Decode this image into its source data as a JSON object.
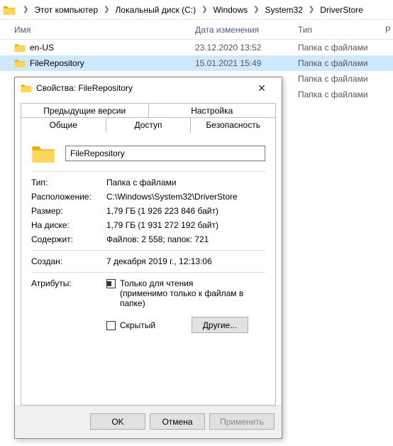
{
  "breadcrumb": {
    "items": [
      "Этот компьютер",
      "Локальный диск (C:)",
      "Windows",
      "System32",
      "DriverStore"
    ]
  },
  "columns": {
    "name": "Имя",
    "date": "Дата изменения",
    "type": "Тип",
    "extra": "Р"
  },
  "rows": [
    {
      "name": "en-US",
      "date": "23.12.2020 13:52",
      "type": "Папка с файлами",
      "selected": false
    },
    {
      "name": "FileRepository",
      "date": "15.01.2021 15:49",
      "type": "Папка с файлами",
      "selected": true
    },
    {
      "name": "",
      "date": "",
      "type": "Папка с файлами",
      "selected": false
    },
    {
      "name": "",
      "date": "",
      "type": "Папка с файлами",
      "selected": false
    }
  ],
  "dialog": {
    "title": "Свойства: FileRepository",
    "tabs": {
      "prev": "Предыдущие версии",
      "custom": "Настройка",
      "general": "Общие",
      "sharing": "Доступ",
      "security": "Безопасность"
    },
    "general": {
      "name_value": "FileRepository",
      "type_label": "Тип:",
      "type_value": "Папка с файлами",
      "location_label": "Расположение:",
      "location_value": "C:\\Windows\\System32\\DriverStore",
      "size_label": "Размер:",
      "size_value": "1,79 ГБ (1 926 223 846 байт)",
      "ondisk_label": "На диске:",
      "ondisk_value": "1,79 ГБ (1 931 272 192 байт)",
      "contains_label": "Содержит:",
      "contains_value": "Файлов: 2 558; папок: 721",
      "created_label": "Создан:",
      "created_value": "7 декабря 2019 г., 12:13:06",
      "attributes_label": "Атрибуты:",
      "readonly_label": "Только для чтения\n(применимо только к файлам в папке)",
      "hidden_label": "Скрытый",
      "other_btn": "Другие..."
    },
    "buttons": {
      "ok": "OK",
      "cancel": "Отмена",
      "apply": "Применить"
    }
  }
}
